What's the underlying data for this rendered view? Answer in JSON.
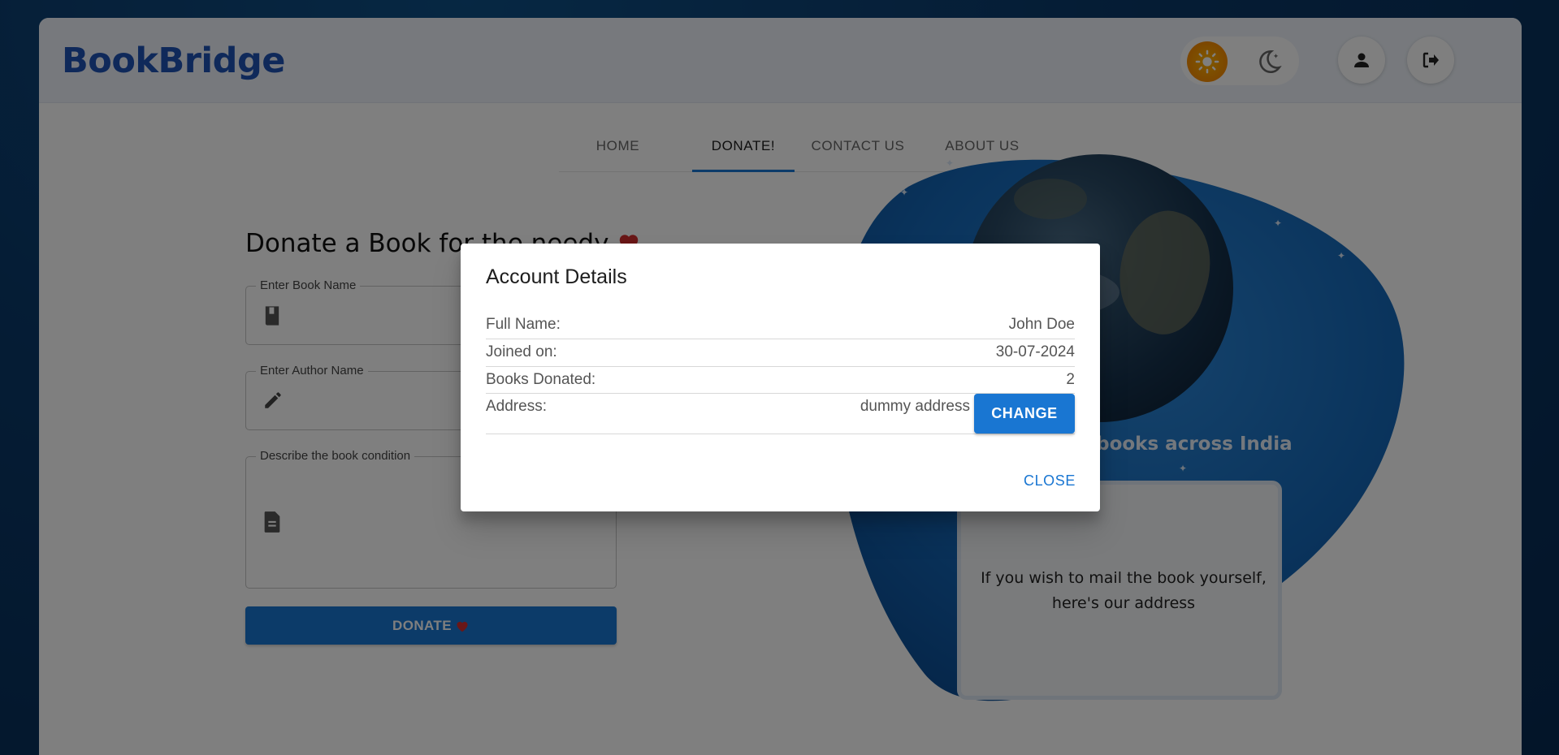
{
  "app": {
    "logo": "BookBridge"
  },
  "header": {
    "light_mode_icon": "sun-icon",
    "dark_mode_icon": "moon-icon",
    "account_icon": "person-icon",
    "logout_icon": "logout-icon"
  },
  "nav": {
    "tabs": [
      {
        "label": "HOME"
      },
      {
        "label": "DONATE!"
      },
      {
        "label": "CONTACT US"
      },
      {
        "label": "ABOUT US"
      }
    ],
    "active_tab": "DONATE!"
  },
  "form": {
    "title": "Donate a Book for the needy",
    "title_icon": "heart-icon",
    "book_name_label": "Enter Book Name",
    "author_name_label": "Enter Author Name",
    "condition_label": "Describe the book condition",
    "donate_label": "DONATE",
    "donate_icon": "heart-icon"
  },
  "art": {
    "caption": "lect books across India",
    "card_text_line1": "If you wish to mail the book yourself,",
    "card_text_line2": "here's our address"
  },
  "dialog": {
    "title": "Account Details",
    "rows": [
      {
        "label": "Full Name:",
        "value": "John Doe"
      },
      {
        "label": "Joined on:",
        "value": "30-07-2024"
      },
      {
        "label": "Books Donated:",
        "value": "2"
      },
      {
        "label": "Address:",
        "value": "dummy address"
      }
    ],
    "change_label": "CHANGE",
    "close_label": "CLOSE"
  },
  "colors": {
    "brand": "#1f53b5",
    "primary": "#1976d2",
    "heart": "#d32f2f",
    "sun": "#f57c00"
  }
}
